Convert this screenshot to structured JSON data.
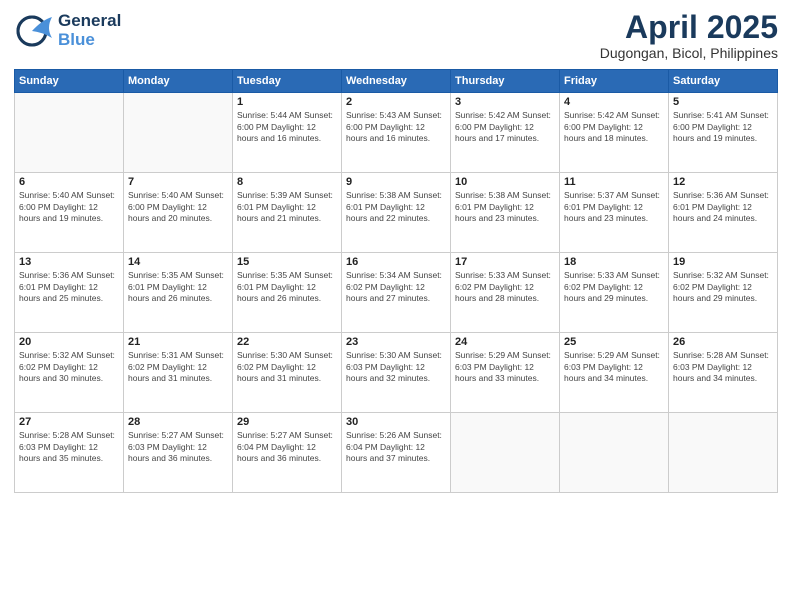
{
  "header": {
    "logo_line1": "General",
    "logo_line2": "Blue",
    "title": "April 2025",
    "subtitle": "Dugongan, Bicol, Philippines"
  },
  "weekdays": [
    "Sunday",
    "Monday",
    "Tuesday",
    "Wednesday",
    "Thursday",
    "Friday",
    "Saturday"
  ],
  "weeks": [
    [
      {
        "day": "",
        "info": ""
      },
      {
        "day": "",
        "info": ""
      },
      {
        "day": "1",
        "info": "Sunrise: 5:44 AM\nSunset: 6:00 PM\nDaylight: 12 hours\nand 16 minutes."
      },
      {
        "day": "2",
        "info": "Sunrise: 5:43 AM\nSunset: 6:00 PM\nDaylight: 12 hours\nand 16 minutes."
      },
      {
        "day": "3",
        "info": "Sunrise: 5:42 AM\nSunset: 6:00 PM\nDaylight: 12 hours\nand 17 minutes."
      },
      {
        "day": "4",
        "info": "Sunrise: 5:42 AM\nSunset: 6:00 PM\nDaylight: 12 hours\nand 18 minutes."
      },
      {
        "day": "5",
        "info": "Sunrise: 5:41 AM\nSunset: 6:00 PM\nDaylight: 12 hours\nand 19 minutes."
      }
    ],
    [
      {
        "day": "6",
        "info": "Sunrise: 5:40 AM\nSunset: 6:00 PM\nDaylight: 12 hours\nand 19 minutes."
      },
      {
        "day": "7",
        "info": "Sunrise: 5:40 AM\nSunset: 6:00 PM\nDaylight: 12 hours\nand 20 minutes."
      },
      {
        "day": "8",
        "info": "Sunrise: 5:39 AM\nSunset: 6:01 PM\nDaylight: 12 hours\nand 21 minutes."
      },
      {
        "day": "9",
        "info": "Sunrise: 5:38 AM\nSunset: 6:01 PM\nDaylight: 12 hours\nand 22 minutes."
      },
      {
        "day": "10",
        "info": "Sunrise: 5:38 AM\nSunset: 6:01 PM\nDaylight: 12 hours\nand 23 minutes."
      },
      {
        "day": "11",
        "info": "Sunrise: 5:37 AM\nSunset: 6:01 PM\nDaylight: 12 hours\nand 23 minutes."
      },
      {
        "day": "12",
        "info": "Sunrise: 5:36 AM\nSunset: 6:01 PM\nDaylight: 12 hours\nand 24 minutes."
      }
    ],
    [
      {
        "day": "13",
        "info": "Sunrise: 5:36 AM\nSunset: 6:01 PM\nDaylight: 12 hours\nand 25 minutes."
      },
      {
        "day": "14",
        "info": "Sunrise: 5:35 AM\nSunset: 6:01 PM\nDaylight: 12 hours\nand 26 minutes."
      },
      {
        "day": "15",
        "info": "Sunrise: 5:35 AM\nSunset: 6:01 PM\nDaylight: 12 hours\nand 26 minutes."
      },
      {
        "day": "16",
        "info": "Sunrise: 5:34 AM\nSunset: 6:02 PM\nDaylight: 12 hours\nand 27 minutes."
      },
      {
        "day": "17",
        "info": "Sunrise: 5:33 AM\nSunset: 6:02 PM\nDaylight: 12 hours\nand 28 minutes."
      },
      {
        "day": "18",
        "info": "Sunrise: 5:33 AM\nSunset: 6:02 PM\nDaylight: 12 hours\nand 29 minutes."
      },
      {
        "day": "19",
        "info": "Sunrise: 5:32 AM\nSunset: 6:02 PM\nDaylight: 12 hours\nand 29 minutes."
      }
    ],
    [
      {
        "day": "20",
        "info": "Sunrise: 5:32 AM\nSunset: 6:02 PM\nDaylight: 12 hours\nand 30 minutes."
      },
      {
        "day": "21",
        "info": "Sunrise: 5:31 AM\nSunset: 6:02 PM\nDaylight: 12 hours\nand 31 minutes."
      },
      {
        "day": "22",
        "info": "Sunrise: 5:30 AM\nSunset: 6:02 PM\nDaylight: 12 hours\nand 31 minutes."
      },
      {
        "day": "23",
        "info": "Sunrise: 5:30 AM\nSunset: 6:03 PM\nDaylight: 12 hours\nand 32 minutes."
      },
      {
        "day": "24",
        "info": "Sunrise: 5:29 AM\nSunset: 6:03 PM\nDaylight: 12 hours\nand 33 minutes."
      },
      {
        "day": "25",
        "info": "Sunrise: 5:29 AM\nSunset: 6:03 PM\nDaylight: 12 hours\nand 34 minutes."
      },
      {
        "day": "26",
        "info": "Sunrise: 5:28 AM\nSunset: 6:03 PM\nDaylight: 12 hours\nand 34 minutes."
      }
    ],
    [
      {
        "day": "27",
        "info": "Sunrise: 5:28 AM\nSunset: 6:03 PM\nDaylight: 12 hours\nand 35 minutes."
      },
      {
        "day": "28",
        "info": "Sunrise: 5:27 AM\nSunset: 6:03 PM\nDaylight: 12 hours\nand 36 minutes."
      },
      {
        "day": "29",
        "info": "Sunrise: 5:27 AM\nSunset: 6:04 PM\nDaylight: 12 hours\nand 36 minutes."
      },
      {
        "day": "30",
        "info": "Sunrise: 5:26 AM\nSunset: 6:04 PM\nDaylight: 12 hours\nand 37 minutes."
      },
      {
        "day": "",
        "info": ""
      },
      {
        "day": "",
        "info": ""
      },
      {
        "day": "",
        "info": ""
      }
    ]
  ]
}
